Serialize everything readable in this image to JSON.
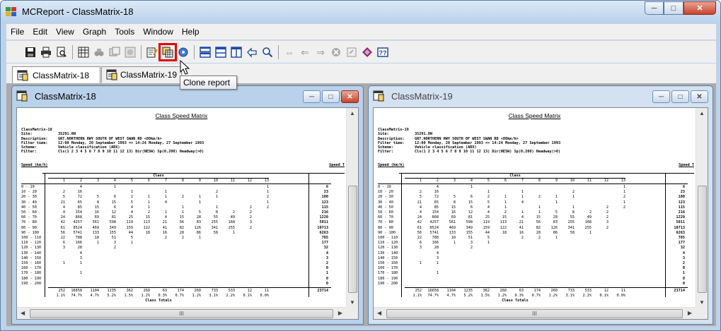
{
  "app": {
    "title": "MCReport - ClassMatrix-18",
    "window_buttons": {
      "minimize": "─",
      "maximize": "□",
      "close": "✕"
    }
  },
  "menu": [
    "File",
    "Edit",
    "View",
    "Graph",
    "Tools",
    "Window",
    "Help"
  ],
  "toolbar": {
    "tooltip": "Clone report",
    "groups": [
      [
        "save-icon",
        "print-icon",
        "print-preview-icon"
      ],
      [
        "report-grid-icon",
        "find-icon",
        "copy-icon",
        "disabled-icon"
      ],
      [
        "edit-report-icon",
        "clone-report-icon",
        "properties-icon"
      ],
      [
        "tile-horizontal-icon",
        "tile-vertical-icon",
        "columns-icon",
        "back-icon",
        "zoom-icon"
      ],
      [
        "double-arrow-icon",
        "arrow-left-icon",
        "arrow-right-icon",
        "stop-icon",
        "export-icon",
        "bookmark-icon",
        "help-icon"
      ]
    ]
  },
  "tabs": [
    {
      "label": "ClassMatrix-18",
      "active": true
    },
    {
      "label": "ClassMatrix-19",
      "active": false
    }
  ],
  "report": {
    "title": "Class Speed Matrix",
    "name": "ClassMatrix-18",
    "meta": [
      {
        "key": "Site:",
        "value": "35291.0N"
      },
      {
        "key": "Description:",
        "value": "GRT.NORTHERN HWY SOUTH OF WEST SWAN RD <80km/h>"
      },
      {
        "key": "Filter time:",
        "value": "12:00 Monday, 20 September 1993 => 14:24 Monday, 27 September 1993"
      },
      {
        "key": "Scheme:",
        "value": "Vehicle classification (ARX)"
      },
      {
        "key": "Filter:",
        "value": "Cls(1 2 3 4 5 6 7 8 9 10 11 12 13) Dir(NESW) Sp(0,200) Headway(>0)"
      }
    ],
    "speed_label": "Speed (km/h)",
    "speed_label_right": "Speed T",
    "class_label": "Class",
    "class_totals_label": "Class Totals",
    "columns": [
      "1",
      "2",
      "3",
      "4",
      "5",
      "6",
      "7",
      "8",
      "9",
      "10",
      "11",
      "12",
      "13"
    ],
    "rows": [
      {
        "range": "0 - 10",
        "values": [
          "",
          "4",
          "",
          "1",
          "",
          "",
          "",
          "",
          "",
          "",
          "",
          "",
          "1"
        ],
        "total": "6"
      },
      {
        "range": "10 - 20",
        "values": [
          "2",
          "16",
          "",
          "",
          "1",
          "",
          "1",
          "",
          "",
          "2",
          "",
          "",
          "1"
        ],
        "total": "23"
      },
      {
        "range": "20 - 30",
        "values": [
          "5",
          "72",
          "5",
          "6",
          "2",
          "1",
          "1",
          "2",
          "1",
          "1",
          "",
          "",
          "2"
        ],
        "total": "100"
      },
      {
        "range": "30 - 40",
        "values": [
          "21",
          "65",
          "8",
          "15",
          "5",
          "1",
          "4",
          "",
          "1",
          "",
          "",
          "",
          "1"
        ],
        "total": "123"
      },
      {
        "range": "40 - 50",
        "values": [
          "4",
          "85",
          "15",
          "6",
          "4",
          "1",
          "",
          "1",
          "",
          "1",
          "",
          "2",
          "2"
        ],
        "total": "115"
      },
      {
        "range": "50 - 60",
        "values": [
          "4",
          "154",
          "16",
          "12",
          "4",
          "2",
          "1",
          "1",
          "5",
          "8",
          "2",
          "2",
          ""
        ],
        "total": "216"
      },
      {
        "range": "60 - 70",
        "values": [
          "24",
          "868",
          "69",
          "81",
          "25",
          "15",
          "4",
          "15",
          "28",
          "55",
          "49",
          "2",
          ""
        ],
        "total": "1220"
      },
      {
        "range": "70 - 80",
        "values": [
          "42",
          "4257",
          "561",
          "598",
          "119",
          "113",
          "21",
          "56",
          "83",
          "255",
          "168",
          "3",
          ""
        ],
        "total": "5011"
      },
      {
        "range": "80 - 90",
        "values": [
          "61",
          "8524",
          "469",
          "349",
          "159",
          "122",
          "41",
          "82",
          "126",
          "341",
          "255",
          "2",
          ""
        ],
        "total": "10713"
      },
      {
        "range": "90 - 100",
        "values": [
          "56",
          "5741",
          "133",
          "155",
          "44",
          "18",
          "16",
          "28",
          "86",
          "58",
          "1",
          "",
          ""
        ],
        "total": "6263"
      },
      {
        "range": "100 - 110",
        "values": [
          "22",
          "788",
          "18",
          "51",
          "5",
          "",
          "2",
          "2",
          "1",
          "",
          "",
          "",
          ""
        ],
        "total": "785"
      },
      {
        "range": "110 - 120",
        "values": [
          "6",
          "166",
          "1",
          "3",
          "1",
          "",
          "",
          "",
          "",
          "",
          "",
          "",
          ""
        ],
        "total": "177"
      },
      {
        "range": "120 - 130",
        "values": [
          "3",
          "28",
          "",
          "2",
          "",
          "",
          "",
          "",
          "",
          "",
          "",
          "",
          ""
        ],
        "total": "32"
      },
      {
        "range": "130 - 140",
        "values": [
          "",
          "4",
          "",
          "",
          "",
          "",
          "",
          "",
          "",
          "",
          "",
          "",
          ""
        ],
        "total": "4"
      },
      {
        "range": "140 - 150",
        "values": [
          "",
          "3",
          "",
          "",
          "",
          "",
          "",
          "",
          "",
          "",
          "",
          "",
          ""
        ],
        "total": "3"
      },
      {
        "range": "150 - 160",
        "values": [
          "1",
          "1",
          "",
          "",
          "",
          "",
          "",
          "",
          "",
          "",
          "",
          "",
          ""
        ],
        "total": "2"
      },
      {
        "range": "160 - 170",
        "values": [
          "",
          "",
          "",
          "",
          "",
          "",
          "",
          "",
          "",
          "",
          "",
          "",
          ""
        ],
        "total": "0"
      },
      {
        "range": "170 - 180",
        "values": [
          "",
          "1",
          "",
          "",
          "",
          "",
          "",
          "",
          "",
          "",
          "",
          "",
          ""
        ],
        "total": "1"
      },
      {
        "range": "180 - 190",
        "values": [
          "",
          "",
          "",
          "",
          "",
          "",
          "",
          "",
          "",
          "",
          "",
          "",
          ""
        ],
        "total": "0"
      },
      {
        "range": "190 - 200",
        "values": [
          "",
          "",
          "",
          "",
          "",
          "",
          "",
          "",
          "",
          "",
          "",
          "",
          ""
        ],
        "total": "0"
      }
    ],
    "totals": [
      "252",
      "16658",
      "1104",
      "1235",
      "362",
      "260",
      "63",
      "174",
      "260",
      "733",
      "533",
      "12",
      "11"
    ],
    "grand_total": "23714",
    "percents": [
      "1.1%",
      "74.7%",
      "4.7%",
      "5.2%",
      "1.5%",
      "1.2%",
      "0.3%",
      "0.7%",
      "1.2%",
      "3.1%",
      "2.2%",
      "0.1%",
      "0.0%"
    ]
  },
  "windows": [
    {
      "title": "ClassMatrix-18",
      "active": true
    },
    {
      "title": "ClassMatrix-19",
      "active": false,
      "name": "ClassMatrix-19"
    }
  ],
  "scroll_thumb_label": "III",
  "colors": {
    "highlight": "#e30000",
    "titlebar": "#b9d1ea",
    "mdi_background": "#ababab"
  }
}
